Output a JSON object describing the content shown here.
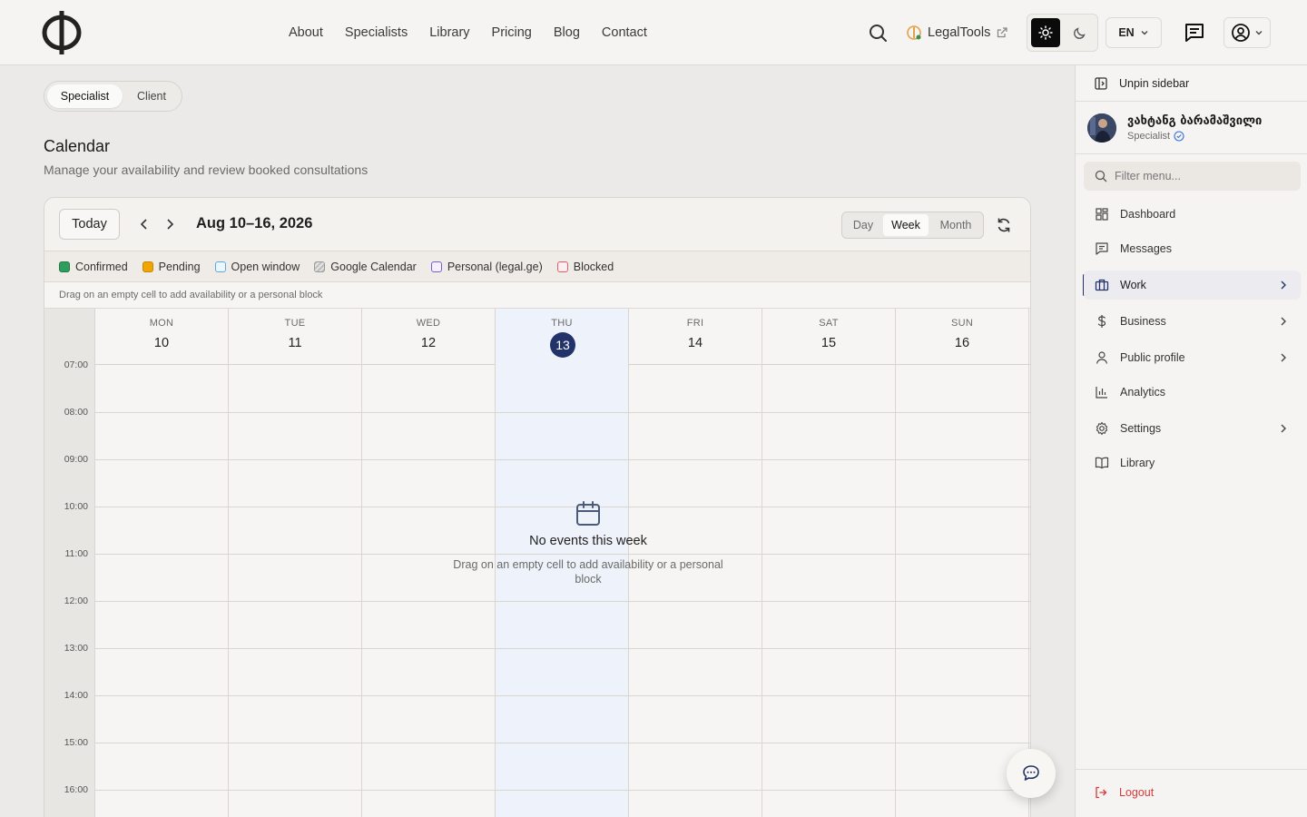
{
  "header": {
    "nav": [
      "About",
      "Specialists",
      "Library",
      "Pricing",
      "Blog",
      "Contact"
    ],
    "legaltools_label": "LegalTools",
    "language": "EN"
  },
  "role_switch": {
    "specialist": "Specialist",
    "client": "Client"
  },
  "page": {
    "title": "Calendar",
    "subtitle": "Manage your availability and review booked consultations"
  },
  "calendar": {
    "today_label": "Today",
    "range_title": "Aug 10–16, 2026",
    "views": {
      "day": "Day",
      "week": "Week",
      "month": "Month"
    },
    "legend": [
      {
        "label": "Confirmed",
        "color": "#2e9e5e"
      },
      {
        "label": "Pending",
        "color": "#f0a500"
      },
      {
        "label": "Open window",
        "color": "#5aa9e6"
      },
      {
        "label": "Google Calendar",
        "color": "#9a9a9a"
      },
      {
        "label": "Personal (legal.ge)",
        "color": "#7c5cd6"
      },
      {
        "label": "Blocked",
        "color": "#e05a6a"
      }
    ],
    "hint": "Drag on an empty cell to add availability or a personal block",
    "days": [
      {
        "name": "MON",
        "num": "10"
      },
      {
        "name": "TUE",
        "num": "11"
      },
      {
        "name": "WED",
        "num": "12"
      },
      {
        "name": "THU",
        "num": "13"
      },
      {
        "name": "FRI",
        "num": "14"
      },
      {
        "name": "SAT",
        "num": "15"
      },
      {
        "name": "SUN",
        "num": "16"
      }
    ],
    "times": [
      "07:00",
      "08:00",
      "09:00",
      "10:00",
      "11:00",
      "12:00",
      "13:00",
      "14:00",
      "15:00",
      "16:00"
    ],
    "empty_title": "No events this week",
    "empty_text": "Drag on an empty cell to add availability or a personal block",
    "today_color": "#22336b"
  },
  "sidebar": {
    "unpin_label": "Unpin sidebar",
    "profile_name": "ვახტანგ ბარამაშვილი",
    "profile_role": "Specialist",
    "filter_placeholder": "Filter menu...",
    "items": [
      {
        "label": "Dashboard",
        "icon": "dashboard-icon"
      },
      {
        "label": "Messages",
        "icon": "messages-icon"
      },
      {
        "label": "Work",
        "icon": "briefcase-icon"
      },
      {
        "label": "Business",
        "icon": "dollar-icon"
      },
      {
        "label": "Public profile",
        "icon": "user-icon"
      },
      {
        "label": "Analytics",
        "icon": "chart-icon"
      },
      {
        "label": "Settings",
        "icon": "gear-icon"
      },
      {
        "label": "Library",
        "icon": "book-icon"
      }
    ],
    "logout_label": "Logout"
  }
}
